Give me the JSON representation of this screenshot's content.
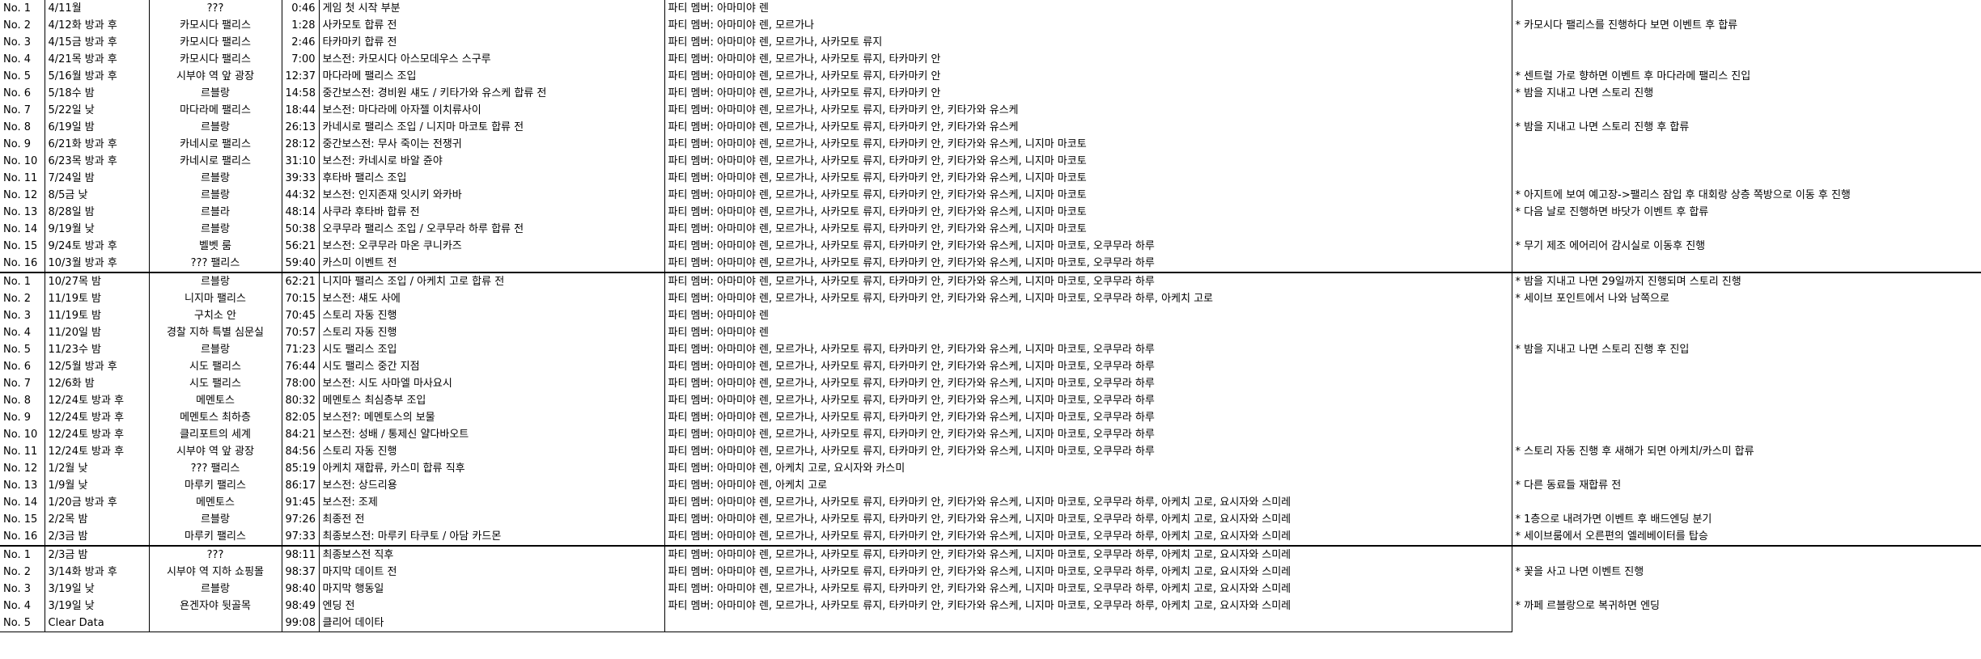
{
  "rows": [
    {
      "no": "No. 1",
      "date": "4/11월",
      "loc": "???",
      "time": "0:46",
      "event": "게임 첫 시작 부분",
      "party": "파티 멤버: 아마미야 렌",
      "note": ""
    },
    {
      "no": "No. 2",
      "date": "4/12화 방과 후",
      "loc": "카모시다 팰리스",
      "time": "1:28",
      "event": "사카모토 합류 전",
      "party": "파티 멤버: 아마미야 렌, 모르가나",
      "note": "* 카모시다 팰리스를 진행하다 보면 이벤트 후 합류"
    },
    {
      "no": "No. 3",
      "date": "4/15금 방과 후",
      "loc": "카모시다 팰리스",
      "time": "2:46",
      "event": "타카마키 합류 전",
      "party": "파티 멤버: 아마미야 렌, 모르가나, 사카모토 류지",
      "note": ""
    },
    {
      "no": "No. 4",
      "date": "4/21목 방과 후",
      "loc": "카모시다 팰리스",
      "time": "7:00",
      "event": "보스전: 카모시다 아스모데우스 스구루",
      "party": "파티 멤버: 아마미야 렌, 모르가나, 사카모토 류지, 타카마키 안",
      "note": ""
    },
    {
      "no": "No. 5",
      "date": "5/16월 방과 후",
      "loc": "시부야 역 앞 광장",
      "time": "12:37",
      "event": "마다라메 팰리스 조입",
      "party": "파티 멤버: 아마미야 렌, 모르가나, 사카모토 류지, 타카마키 안",
      "note": "* 센트럴 가로 향하면 이벤트 후 마다라메 팰리스 진입"
    },
    {
      "no": "No. 6",
      "date": "5/18수 밤",
      "loc": "르블랑",
      "time": "14:58",
      "event": "중간보스전: 경비원 섀도 / 키타가와 유스케 합류 전",
      "party": "파티 멤버: 아마미야 렌, 모르가나, 사카모토 류지, 타카마키 안",
      "note": "* 밤을 지내고 나면 스토리 진행"
    },
    {
      "no": "No. 7",
      "date": "5/22일 낮",
      "loc": "마다라메 팰리스",
      "time": "18:44",
      "event": "보스전: 마다라메 아자젤 이치류사이",
      "party": "파티 멤버: 아마미야 렌, 모르가나, 사카모토 류지, 타카마키 안, 키타가와 유스케",
      "note": ""
    },
    {
      "no": "No. 8",
      "date": "6/19일 밤",
      "loc": "르블랑",
      "time": "26:13",
      "event": "카네시로 팰리스 조입 / 니지마 마코토 합류 전",
      "party": "파티 멤버: 아마미야 렌, 모르가나, 사카모토 류지, 타카마키 안, 키타가와 유스케",
      "note": "* 밤을 지내고 나면 스토리 진행 후 합류"
    },
    {
      "no": "No. 9",
      "date": "6/21화 방과 후",
      "loc": "카네시로 팰리스",
      "time": "28:12",
      "event": "중간보스전: 무사 죽이는 전쟁귀",
      "party": "파티 멤버: 아마미야 렌, 모르가나, 사카모토 류지, 타카마키 안, 키타가와 유스케, 니지마 마코토",
      "note": ""
    },
    {
      "no": "No. 10",
      "date": "6/23목 방과 후",
      "loc": "카네시로 팰리스",
      "time": "31:10",
      "event": "보스전: 카네시로 바알 쥰야",
      "party": "파티 멤버: 아마미야 렌, 모르가나, 사카모토 류지, 타카마키 안, 키타가와 유스케, 니지마 마코토",
      "note": ""
    },
    {
      "no": "No. 11",
      "date": "7/24일 밤",
      "loc": "르블랑",
      "time": "39:33",
      "event": "후타바 팰리스 조입",
      "party": "파티 멤버: 아마미야 렌, 모르가나, 사카모토 류지, 타카마키 안, 키타가와 유스케, 니지마 마코토",
      "note": ""
    },
    {
      "no": "No. 12",
      "date": "8/5금 낮",
      "loc": "르블랑",
      "time": "44:32",
      "event": "보스전: 인지존재 잇시키 와카바",
      "party": "파티 멤버: 아마미야 렌, 모르가나, 사카모토 류지, 타카마키 안, 키타가와 유스케, 니지마 마코토",
      "note": "* 아지트에 보여 예고장->팰리스 잠입 후 대회랑 상층 쪽방으로 이동 후 진행"
    },
    {
      "no": "No. 13",
      "date": "8/28일 밤",
      "loc": "르블라",
      "time": "48:14",
      "event": "사쿠라 후타바 합류 전",
      "party": "파티 멤버: 아마미야 렌, 모르가나, 사카모토 류지, 타카마키 안, 키타가와 유스케, 니지마 마코토",
      "note": "* 다음 날로 진행하면 바닷가 이벤트 후 합류"
    },
    {
      "no": "No. 14",
      "date": "9/19월 낮",
      "loc": "르블랑",
      "time": "50:38",
      "event": "오쿠무라 팰리스 조입 / 오쿠무라 하루 합류 전",
      "party": "파티 멤버: 아마미야 렌, 모르가나, 사카모토 류지, 타카마키 안, 키타가와 유스케, 니지마 마코토",
      "note": ""
    },
    {
      "no": "No. 15",
      "date": "9/24토 방과 후",
      "loc": "벨벳 룸",
      "time": "56:21",
      "event": "보스전: 오쿠무라 마온 쿠니카즈",
      "party": "파티 멤버: 아마미야 렌, 모르가나, 사카모토 류지, 타카마키 안, 키타가와 유스케, 니지마 마코토, 오쿠무라 하루",
      "note": "* 무기 제조 에어리어 감시실로 이동후 진행"
    },
    {
      "no": "No. 16",
      "date": "10/3월 방과 후",
      "loc": "??? 팰리스",
      "time": "59:40",
      "event": "카스미 이벤트 전",
      "party": "파티 멤버: 아마미야 렌, 모르가나, 사카모토 류지, 타카마키 안, 키타가와 유스케, 니지마 마코토, 오쿠무라 하루",
      "note": "",
      "sep": true
    },
    {
      "no": "No. 1",
      "date": "10/27목 밤",
      "loc": "르블랑",
      "time": "62:21",
      "event": "니지마 팰리스 조입 / 아케치 고로 합류 전",
      "party": "파티 멤버: 아마미야 렌, 모르가나, 사카모토 류지, 타카마키 안, 키타가와 유스케, 니지마 마코토, 오쿠무라 하루",
      "note": "* 밤을 지내고 나면 29일까지 진행되며 스토리 진행"
    },
    {
      "no": "No. 2",
      "date": "11/19토 밤",
      "loc": "니지마 팰리스",
      "time": "70:15",
      "event": "보스전: 섀도 사에",
      "party": "파티 멤버: 아마미야 렌, 모르가나, 사카모토 류지, 타카마키 안, 키타가와 유스케, 니지마 마코토, 오쿠무라 하루, 아케치 고로",
      "note": "* 세이브 포인트에서 나와 남쪽으로"
    },
    {
      "no": "No. 3",
      "date": "11/19토 밤",
      "loc": "구치소 안",
      "time": "70:45",
      "event": "스토리 자동 진행",
      "party": "파티 멤버: 아마미야 렌",
      "note": ""
    },
    {
      "no": "No. 4",
      "date": "11/20일 밤",
      "loc": "경찰 지하 특별 심문실",
      "time": "70:57",
      "event": "스토리 자동 진행",
      "party": "파티 멤버: 아마미야 렌",
      "note": ""
    },
    {
      "no": "No. 5",
      "date": "11/23수 밤",
      "loc": "르블랑",
      "time": "71:23",
      "event": "시도 팰리스 조입",
      "party": "파티 멤버: 아마미야 렌, 모르가나, 사카모토 류지, 타카마키 안, 키타가와 유스케, 니지마 마코토, 오쿠무라 하루",
      "note": "* 밤을 지내고 나면 스토리 진행 후 진입"
    },
    {
      "no": "No. 6",
      "date": "12/5월 방과 후",
      "loc": "시도 팰리스",
      "time": "76:44",
      "event": "시도 팰리스 중간 지점",
      "party": "파티 멤버: 아마미야 렌, 모르가나, 사카모토 류지, 타카마키 안, 키타가와 유스케, 니지마 마코토, 오쿠무라 하루",
      "note": ""
    },
    {
      "no": "No. 7",
      "date": "12/6화 밤",
      "loc": "시도 팰리스",
      "time": "78:00",
      "event": "보스전: 시도 사마엘 마사요시",
      "party": "파티 멤버: 아마미야 렌, 모르가나, 사카모토 류지, 타카마키 안, 키타가와 유스케, 니지마 마코토, 오쿠무라 하루",
      "note": ""
    },
    {
      "no": "No. 8",
      "date": "12/24토 방과 후",
      "loc": "메멘토스",
      "time": "80:32",
      "event": "메멘토스 최심층부 조입",
      "party": "파티 멤버: 아마미야 렌, 모르가나, 사카모토 류지, 타카마키 안, 키타가와 유스케, 니지마 마코토, 오쿠무라 하루",
      "note": ""
    },
    {
      "no": "No. 9",
      "date": "12/24토 방과 후",
      "loc": "메멘토스 최하층",
      "time": "82:05",
      "event": "보스전?: 메멘토스의 보물",
      "party": "파티 멤버: 아마미야 렌, 모르가나, 사카모토 류지, 타카마키 안, 키타가와 유스케, 니지마 마코토, 오쿠무라 하루",
      "note": ""
    },
    {
      "no": "No. 10",
      "date": "12/24토 방과 후",
      "loc": "클리포트의 세계",
      "time": "84:21",
      "event": "보스전: 성배 / 통제신 얄다바오트",
      "party": "파티 멤버: 아마미야 렌, 모르가나, 사카모토 류지, 타카마키 안, 키타가와 유스케, 니지마 마코토, 오쿠무라 하루",
      "note": ""
    },
    {
      "no": "No. 11",
      "date": "12/24토 방과 후",
      "loc": "시부야 역 앞 광장",
      "time": "84:56",
      "event": "스토리 자동 진행",
      "party": "파티 멤버: 아마미야 렌, 모르가나, 사카모토 류지, 타카마키 안, 키타가와 유스케, 니지마 마코토, 오쿠무라 하루",
      "note": "* 스토리 자동 진행 후 새해가 되면 아케치/카스미 합류"
    },
    {
      "no": "No. 12",
      "date": "1/2월 낮",
      "loc": "??? 팰리스",
      "time": "85:19",
      "event": "아케치 재합류, 카스미 합류 직후",
      "party": "파티 멤버: 아마미야 렌, 아케치 고로, 요시자와 카스미",
      "note": ""
    },
    {
      "no": "No. 13",
      "date": "1/9월 낮",
      "loc": "마루키 팰리스",
      "time": "86:17",
      "event": "보스전: 상드리용",
      "party": "파티 멤버: 아마미야 렌, 아케치 고로",
      "note": "* 다른 동료들 재합류 전"
    },
    {
      "no": "No. 14",
      "date": "1/20금 방과 후",
      "loc": "메멘토스",
      "time": "91:45",
      "event": "보스전: 조제",
      "party": "파티 멤버: 아마미야 렌, 모르가나, 사카모토 류지, 타카마키 안, 키타가와 유스케, 니지마 마코토, 오쿠무라 하루, 아케치 고로, 요시자와 스미레",
      "note": ""
    },
    {
      "no": "No. 15",
      "date": "2/2목 밤",
      "loc": "르블랑",
      "time": "97:26",
      "event": "최종전 전",
      "party": "파티 멤버: 아마미야 렌, 모르가나, 사카모토 류지, 타카마키 안, 키타가와 유스케, 니지마 마코토, 오쿠무라 하루, 아케치 고로, 요시자와 스미레",
      "note": "* 1층으로 내려가면 이벤트 후 배드엔딩 분기"
    },
    {
      "no": "No. 16",
      "date": "2/3금 밤",
      "loc": "마루키 팰리스",
      "time": "97:33",
      "event": "최종보스전: 마루키 타쿠토 / 아담 카드몬",
      "party": "파티 멤버: 아마미야 렌, 모르가나, 사카모토 류지, 타카마키 안, 키타가와 유스케, 니지마 마코토, 오쿠무라 하루, 아케치 고로, 요시자와 스미레",
      "note": "* 세이브룸에서 오른편의 엘레베이터를 탑승",
      "sep": true
    },
    {
      "no": "No. 1",
      "date": "2/3금 밤",
      "loc": "???",
      "time": "98:11",
      "event": "최종보스전 직후",
      "party": "파티 멤버: 아마미야 렌, 모르가나, 사카모토 류지, 타카마키 안, 키타가와 유스케, 니지마 마코토, 오쿠무라 하루, 아케치 고로, 요시자와 스미레",
      "note": ""
    },
    {
      "no": "No. 2",
      "date": "3/14화 방과 후",
      "loc": "시부야 역 지하 쇼핑몰",
      "time": "98:37",
      "event": "마지막 데이트 전",
      "party": "파티 멤버: 아마미야 렌, 모르가나, 사카모토 류지, 타카마키 안, 키타가와 유스케, 니지마 마코토, 오쿠무라 하루, 아케치 고로, 요시자와 스미레",
      "note": "* 꽃을 사고 나면 이벤트 진행"
    },
    {
      "no": "No. 3",
      "date": "3/19일 낮",
      "loc": "르블랑",
      "time": "98:40",
      "event": "마지막 행동일",
      "party": "파티 멤버: 아마미야 렌, 모르가나, 사카모토 류지, 타카마키 안, 키타가와 유스케, 니지마 마코토, 오쿠무라 하루, 아케치 고로, 요시자와 스미레",
      "note": ""
    },
    {
      "no": "No. 4",
      "date": "3/19일 낮",
      "loc": "욘겐자야 뒷골목",
      "time": "98:49",
      "event": "엔딩 전",
      "party": "파티 멤버: 아마미야 렌, 모르가나, 사카모토 류지, 타카마키 안, 키타가와 유스케, 니지마 마코토, 오쿠무라 하루, 아케치 고로, 요시자와 스미레",
      "note": "* 까페 르블랑으로 복귀하면 엔딩"
    },
    {
      "no": "No. 5",
      "date": "Clear Data",
      "loc": "",
      "time": "99:08",
      "event": "클리어 데이타",
      "party": "",
      "note": "",
      "bottom": true
    }
  ]
}
